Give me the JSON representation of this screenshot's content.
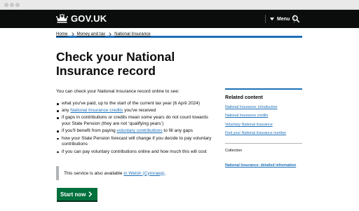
{
  "header": {
    "logo_text": "GOV.UK",
    "menu_label": "Menu",
    "search_label": "Search"
  },
  "breadcrumb": {
    "items": [
      "Home",
      "Money and tax",
      "National Insurance"
    ]
  },
  "page_title": "Check your National Insurance record",
  "intro": "You can check your National Insurance record online to see:",
  "checklist": {
    "item1": "what you've paid, up to the start of the current tax year (6 April 2024)",
    "item2_pre": "any ",
    "item2_link": "National Insurance credits",
    "item2_post": " you've received",
    "item3": "if gaps in contributions or credits mean some years do not count towards your State Pension (they are not ‘qualifying years’)",
    "item4_pre": "if you'll benefit from paying ",
    "item4_link": "voluntary contributions",
    "item4_post": " to fill any gaps",
    "item5": "how your State Pension forecast will change if you decide to pay voluntary contributions",
    "item6": "if you can pay voluntary contributions online and how much this will cost"
  },
  "inset": {
    "text": "This service is also available ",
    "link": "in Welsh (Cymraeg)",
    "end": "."
  },
  "start_button": "Start now",
  "related": {
    "heading": "Related content",
    "links": [
      "National Insurance: introduction",
      "National Insurance credits",
      "Voluntary National Insurance",
      "Find your National Insurance number"
    ],
    "collection_label": "Collection",
    "collection_link": "National Insurance: detailed information"
  },
  "colors": {
    "header_bg": "#0b0c0c",
    "link": "#1d70b8",
    "start_button": "#00703c",
    "brand_bar": "#1d70b8"
  },
  "icons": [
    "crown-icon",
    "chevron-down-icon",
    "search-icon",
    "arrow-right-icon"
  ]
}
